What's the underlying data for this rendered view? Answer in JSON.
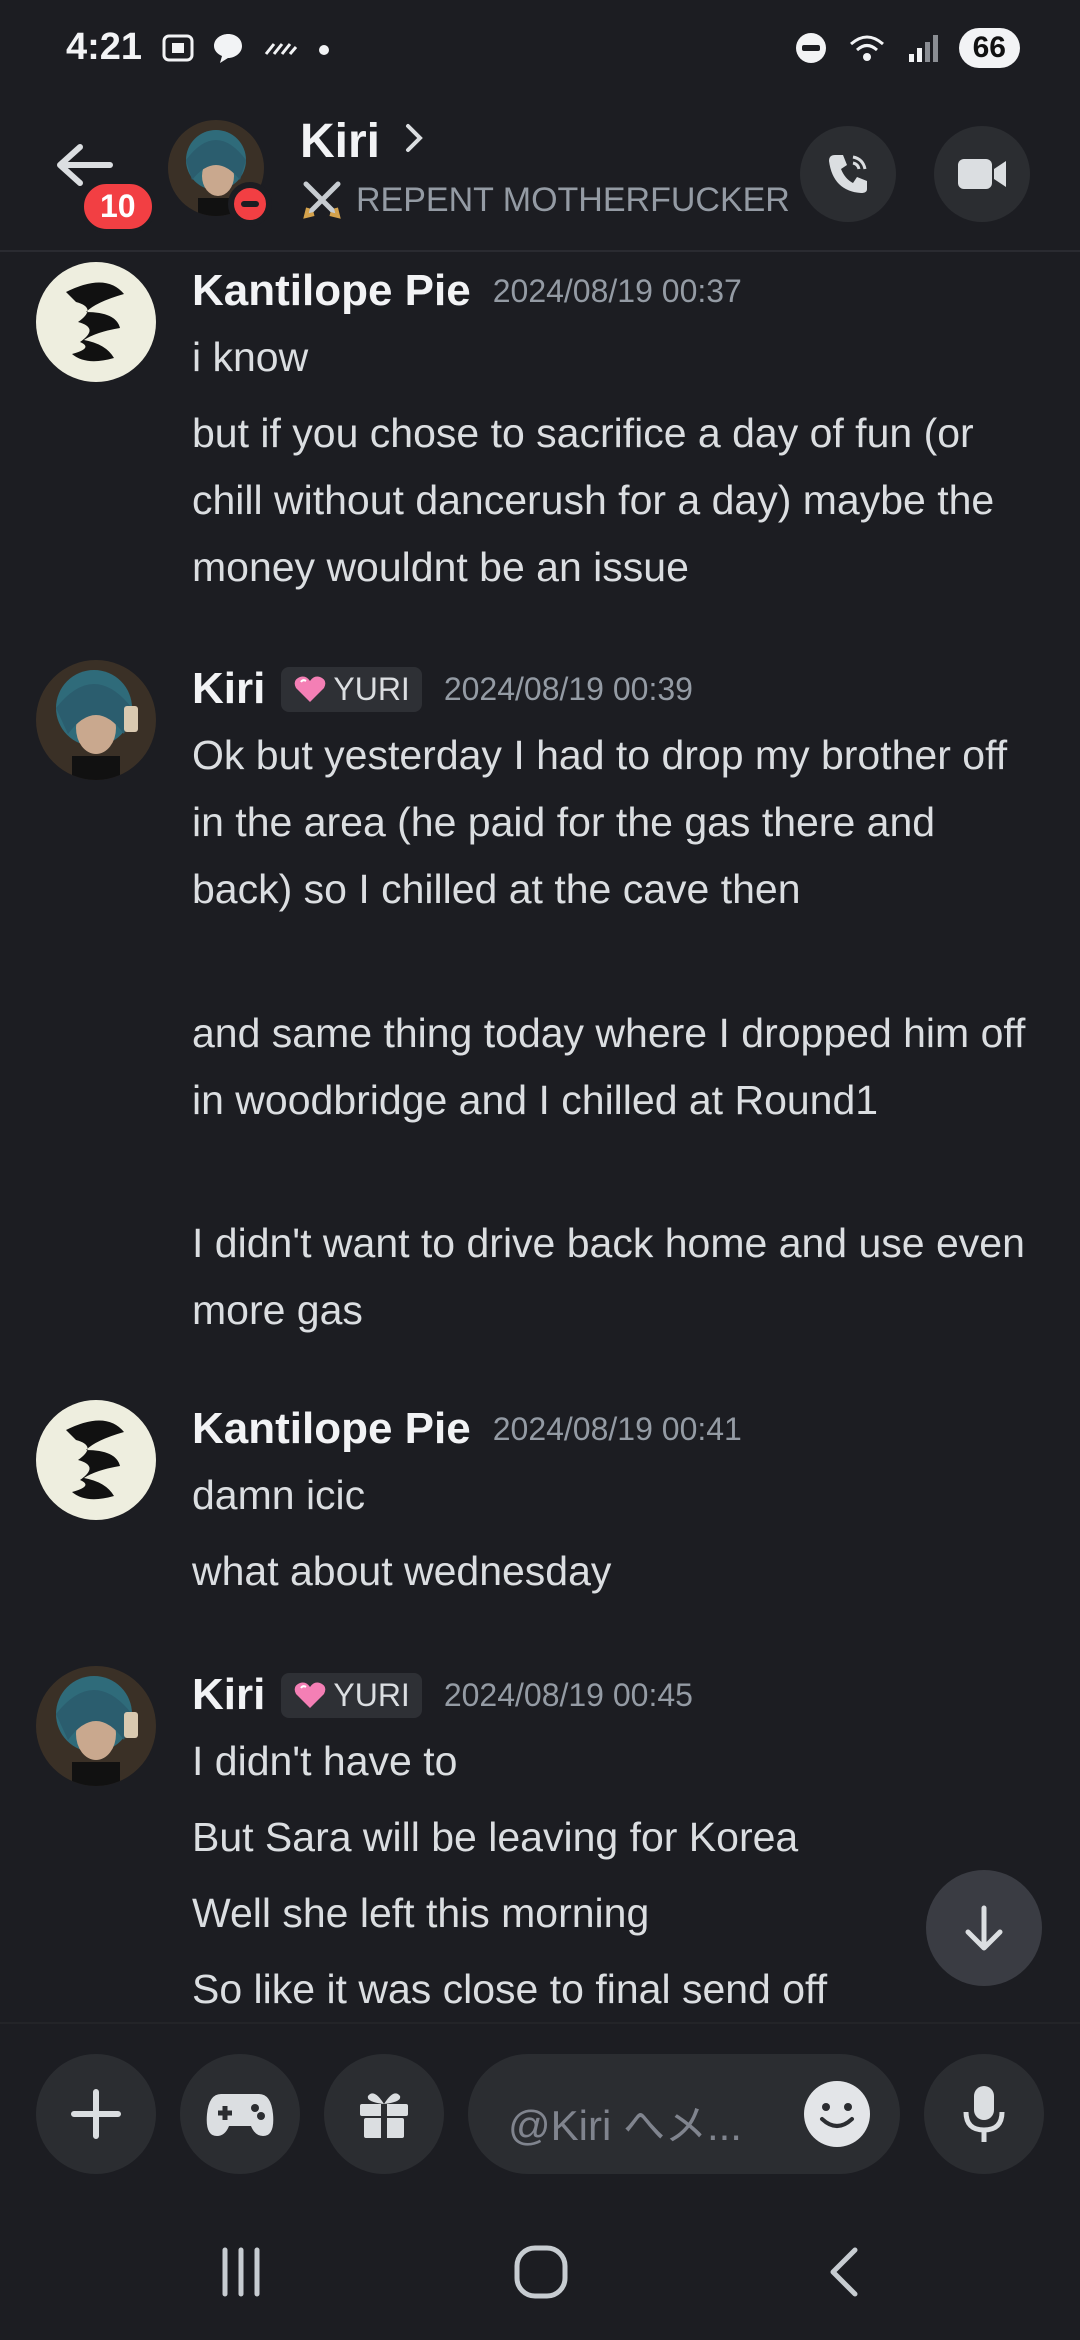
{
  "status_bar": {
    "time": "4:21",
    "battery": "66"
  },
  "header": {
    "unread_badge": "10",
    "name": "Kiri",
    "status_text": "REPENT MOTHERFUCKER"
  },
  "messages": [
    {
      "author": "Kantilope Pie",
      "timestamp": "2024/08/19 00:37",
      "lines": [
        "i know",
        "but if you chose to sacrifice a day of fun (or chill without dancerush for a day) maybe the money wouldnt be an issue"
      ]
    },
    {
      "author": "Kiri",
      "role": "YURI",
      "timestamp": "2024/08/19 00:39",
      "lines": [
        "Ok but yesterday I had to drop my brother off in the area (he paid for the gas there and back) so I  chilled at the cave then",
        "and same thing today where I dropped him off in woodbridge and I chilled at Round1",
        "I didn't want to drive back home and use even more gas"
      ]
    },
    {
      "author": "Kantilope Pie",
      "timestamp": "2024/08/19 00:41",
      "lines": [
        "damn icic",
        "what about wednesday"
      ]
    },
    {
      "author": "Kiri",
      "role": "YURI",
      "timestamp": "2024/08/19 00:45",
      "lines": [
        "I didn't have to",
        "But Sara will be leaving for Korea",
        "Well she left this morning",
        "So like it was close to final send off"
      ]
    }
  ],
  "composer": {
    "placeholder": "@Kiri へメ..."
  }
}
